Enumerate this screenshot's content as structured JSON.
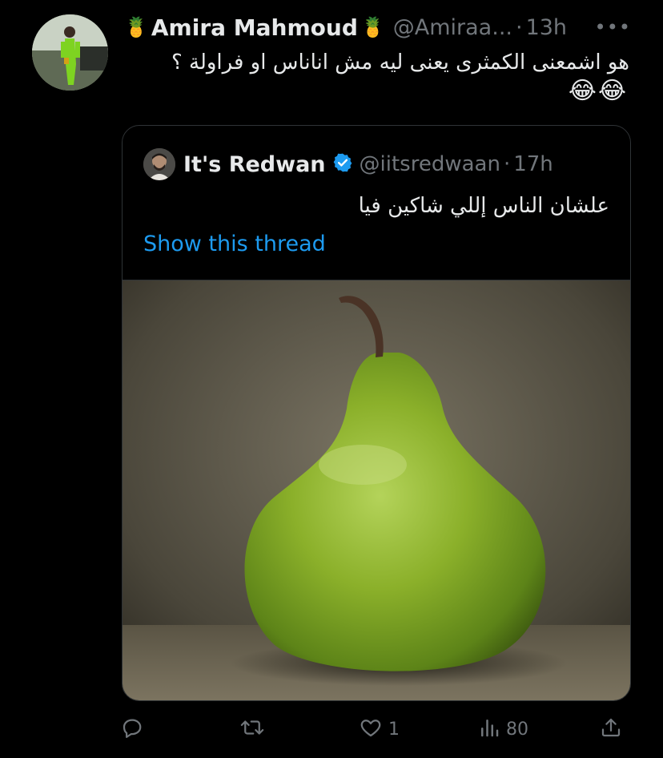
{
  "tweet": {
    "name": "Amira Mahmoud",
    "name_prefix_emoji": "🍍",
    "name_suffix_emoji": "🍍",
    "handle": "@Amiraa...",
    "separator": "·",
    "time": "13h",
    "more_label": "•••",
    "text": "هو اشمعنى الكمثرى يعنى ليه مش اناناس او فراولة ؟",
    "emoji_line": "😂😂"
  },
  "quote": {
    "name": "It's Redwan",
    "verified": true,
    "handle": "@iitsredwaan",
    "separator": "·",
    "time": "17h",
    "text": "علشان الناس إللي شاكين فيا",
    "show_thread": "Show this thread",
    "media": {
      "subject": "green pear",
      "icon": "pear-photo"
    }
  },
  "actions": {
    "reply": {
      "icon": "reply-icon"
    },
    "retweet": {
      "icon": "retweet-icon"
    },
    "like": {
      "icon": "heart-icon",
      "count": "1"
    },
    "views": {
      "icon": "views-icon",
      "count": "80"
    },
    "share": {
      "icon": "share-icon"
    }
  },
  "colors": {
    "background": "#000000",
    "text": "#e7e9ea",
    "secondary": "#71767b",
    "link": "#1d9bf0",
    "border": "#2f3336",
    "verified": "#1d9bf0"
  }
}
